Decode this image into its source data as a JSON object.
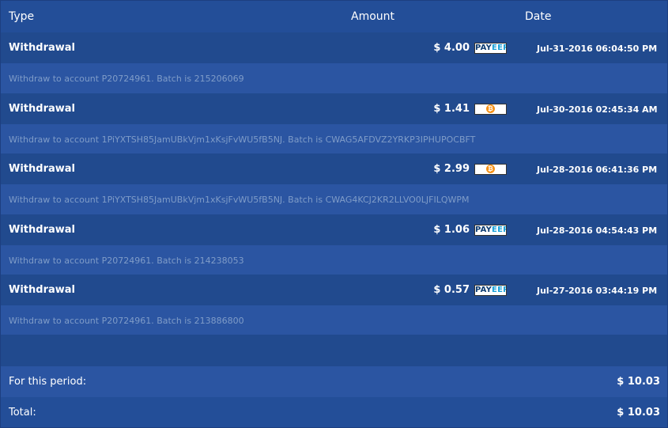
{
  "header": {
    "type": "Type",
    "amount": "Amount",
    "date": "Date"
  },
  "transactions": [
    {
      "type": "Withdrawal",
      "amount": "$ 4.00",
      "method": "payeer",
      "payeer_a": "PAY",
      "payeer_b": "EER",
      "date": "Jul-31-2016 06:04:50 PM",
      "description": "Withdraw to account P20724961. Batch is 215206069"
    },
    {
      "type": "Withdrawal",
      "amount": "$ 1.41",
      "method": "bitcoin",
      "date": "Jul-30-2016 02:45:34 AM",
      "description": "Withdraw to account 1PiYXTSH85JamUBkVjm1xKsjFvWU5fB5NJ. Batch is CWAG5AFDVZ2YRKP3IPHUPOCBFT"
    },
    {
      "type": "Withdrawal",
      "amount": "$ 2.99",
      "method": "bitcoin",
      "date": "Jul-28-2016 06:41:36 PM",
      "description": "Withdraw to account 1PiYXTSH85JamUBkVjm1xKsjFvWU5fB5NJ. Batch is CWAG4KCJ2KR2LLVO0LJFILQWPM"
    },
    {
      "type": "Withdrawal",
      "amount": "$ 1.06",
      "method": "payeer",
      "payeer_a": "PAY",
      "payeer_b": "EER",
      "date": "Jul-28-2016 04:54:43 PM",
      "description": "Withdraw to account P20724961. Batch is 214238053"
    },
    {
      "type": "Withdrawal",
      "amount": "$ 0.57",
      "method": "payeer",
      "payeer_a": "PAY",
      "payeer_b": "EER",
      "date": "Jul-27-2016 03:44:19 PM",
      "description": "Withdraw to account P20724961. Batch is 213886800"
    }
  ],
  "summary": {
    "period_label": "For this period:",
    "period_value": "$ 10.03",
    "total_label": "Total:",
    "total_value": "$ 10.03"
  },
  "colors": {
    "background": "#2b55a2",
    "row_dark": "#214a8e",
    "desc_text": "#7f9cc8",
    "bitcoin": "#f7931a",
    "payeer_dark": "#0f3d72",
    "payeer_light": "#19a0d8"
  }
}
